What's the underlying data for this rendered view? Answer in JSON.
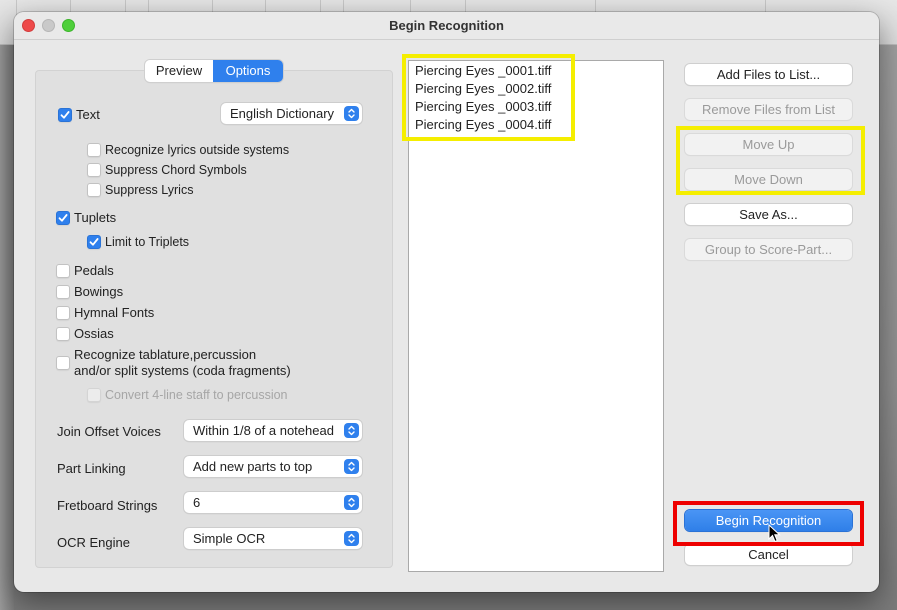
{
  "window": {
    "title": "Begin Recognition"
  },
  "tabs": [
    {
      "label": "Preview",
      "selected": false
    },
    {
      "label": "Options",
      "selected": true
    }
  ],
  "options": {
    "text": {
      "label": "Text",
      "checked": true
    },
    "text_dictionary": {
      "value": "English Dictionary"
    },
    "recognize_lyrics": {
      "label": "Recognize lyrics outside systems",
      "checked": false
    },
    "suppress_chords": {
      "label": "Suppress Chord Symbols",
      "checked": false
    },
    "suppress_lyrics": {
      "label": "Suppress Lyrics",
      "checked": false
    },
    "tuplets": {
      "label": "Tuplets",
      "checked": true
    },
    "limit_triplets": {
      "label": "Limit to Triplets",
      "checked": true
    },
    "pedals": {
      "label": "Pedals",
      "checked": false
    },
    "bowings": {
      "label": "Bowings",
      "checked": false
    },
    "hymnal_fonts": {
      "label": "Hymnal Fonts",
      "checked": false
    },
    "ossias": {
      "label": "Ossias",
      "checked": false
    },
    "tablature": {
      "label_line1": "Recognize tablature,percussion",
      "label_line2": "and/or split systems (coda fragments)",
      "checked": false
    },
    "convert_4line": {
      "label": "Convert 4-line staff to percussion",
      "checked": false,
      "disabled": true
    },
    "join_offset_voices": {
      "label": "Join Offset Voices",
      "value": "Within 1/8 of a notehead"
    },
    "part_linking": {
      "label": "Part Linking",
      "value": "Add new parts to top"
    },
    "fretboard_strings": {
      "label": "Fretboard Strings",
      "value": "6"
    },
    "ocr_engine": {
      "label": "OCR Engine",
      "value": "Simple OCR"
    }
  },
  "files": [
    "Piercing Eyes _0001.tiff",
    "Piercing Eyes _0002.tiff",
    "Piercing Eyes _0003.tiff",
    "Piercing Eyes _0004.tiff"
  ],
  "buttons": {
    "add_files": {
      "label": "Add Files to List...",
      "enabled": true
    },
    "remove_files": {
      "label": "Remove Files from List",
      "enabled": false
    },
    "move_up": {
      "label": "Move Up",
      "enabled": false
    },
    "move_down": {
      "label": "Move Down",
      "enabled": false
    },
    "save_as": {
      "label": "Save As...",
      "enabled": true
    },
    "group_to_score": {
      "label": "Group to Score-Part...",
      "enabled": false
    },
    "begin_recognition": {
      "label": "Begin Recognition",
      "enabled": true,
      "default": true
    },
    "cancel": {
      "label": "Cancel",
      "enabled": true
    }
  },
  "annotations": {
    "highlight_yellow": "#f5ee00",
    "highlight_red": "#ee0000"
  },
  "colors": {
    "accent": "#2f80ed"
  }
}
